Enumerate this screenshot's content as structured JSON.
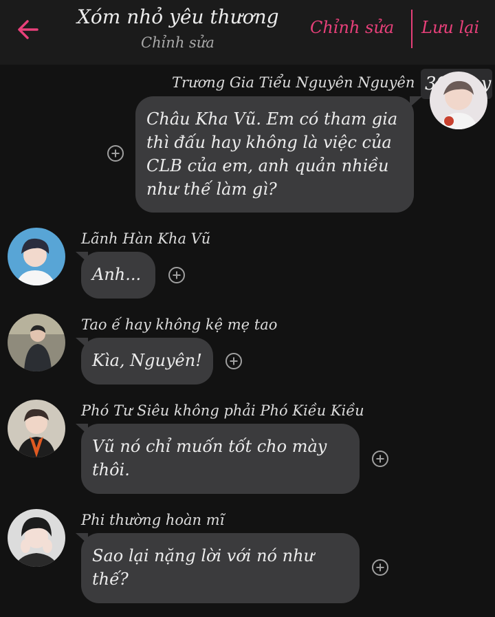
{
  "header": {
    "title": "Xóm nhỏ yêu thương",
    "subtitle": "Chỉnh sửa",
    "edit_label": "Chỉnh sửa",
    "save_label": "Lưu lại",
    "back_icon": "arrow-left-icon",
    "accent_color": "#e8407a"
  },
  "messages": [
    {
      "side": "right",
      "sender": "Trương Gia Tiểu Nguyên Nguyên",
      "badge": "397 joy",
      "text": "Châu Kha Vũ. Em có tham gia thì đấu hay không là việc của CLB của em, anh quản nhiều như thế làm gì?"
    },
    {
      "side": "left",
      "sender": "Lãnh Hàn Kha Vũ",
      "text": "Anh..."
    },
    {
      "side": "left",
      "sender": "Tao ế hay không kệ mẹ tao",
      "text": "Kìa, Nguyên!"
    },
    {
      "side": "left",
      "sender": "Phó Tư Siêu không phải Phó Kiều Kiều",
      "text": "Vũ nó chỉ muốn tốt cho mày thôi."
    },
    {
      "side": "left",
      "sender": "Phi thường hoàn mĩ",
      "text": "Sao lại nặng lời với nó như thế?"
    }
  ],
  "icons": {
    "add": "plus-circle-icon",
    "avatar": "avatar-photo"
  },
  "colors": {
    "background": "#121212",
    "bubble": "#3b3b3d",
    "header": "#1b1b1b"
  }
}
